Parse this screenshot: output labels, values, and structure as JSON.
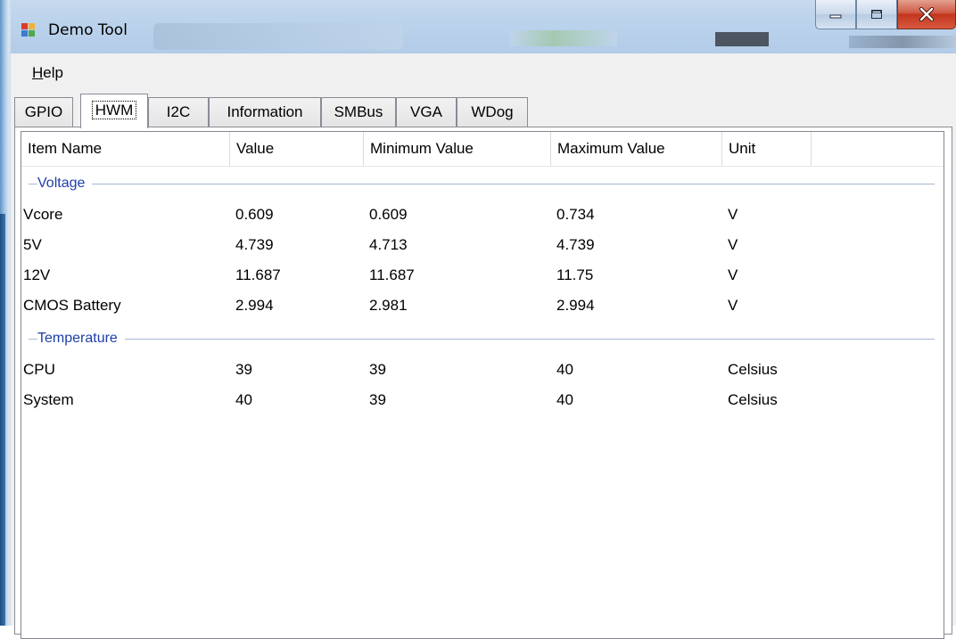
{
  "window": {
    "title": "Demo Tool",
    "controls": {
      "minimize": "minimize",
      "maximize": "maximize",
      "close": "close"
    }
  },
  "menu": {
    "help_prefix": "H",
    "help_rest": "elp"
  },
  "tabs": [
    {
      "label": "GPIO",
      "active": false
    },
    {
      "label": "HWM",
      "active": true
    },
    {
      "label": "I2C",
      "active": false
    },
    {
      "label": "Information",
      "active": false
    },
    {
      "label": "SMBus",
      "active": false
    },
    {
      "label": "VGA",
      "active": false
    },
    {
      "label": "WDog",
      "active": false
    }
  ],
  "table": {
    "columns": [
      "Item Name",
      "Value",
      "Minimum Value",
      "Maximum Value",
      "Unit"
    ],
    "groups": [
      {
        "name": "Voltage",
        "rows": [
          [
            "Vcore",
            "0.609",
            "0.609",
            "0.734",
            "V"
          ],
          [
            "5V",
            "4.739",
            "4.713",
            "4.739",
            "V"
          ],
          [
            "12V",
            "11.687",
            "11.687",
            "11.75",
            "V"
          ],
          [
            "CMOS Battery",
            "2.994",
            "2.981",
            "2.994",
            "V"
          ]
        ]
      },
      {
        "name": "Temperature",
        "rows": [
          [
            "CPU",
            "39",
            "39",
            "40",
            "Celsius"
          ],
          [
            "System",
            "40",
            "39",
            "40",
            "Celsius"
          ]
        ]
      }
    ]
  },
  "colors": {
    "group_header": "#1e3fa8",
    "titlebar": "#bcd3ec",
    "close_button": "#c3361e"
  }
}
